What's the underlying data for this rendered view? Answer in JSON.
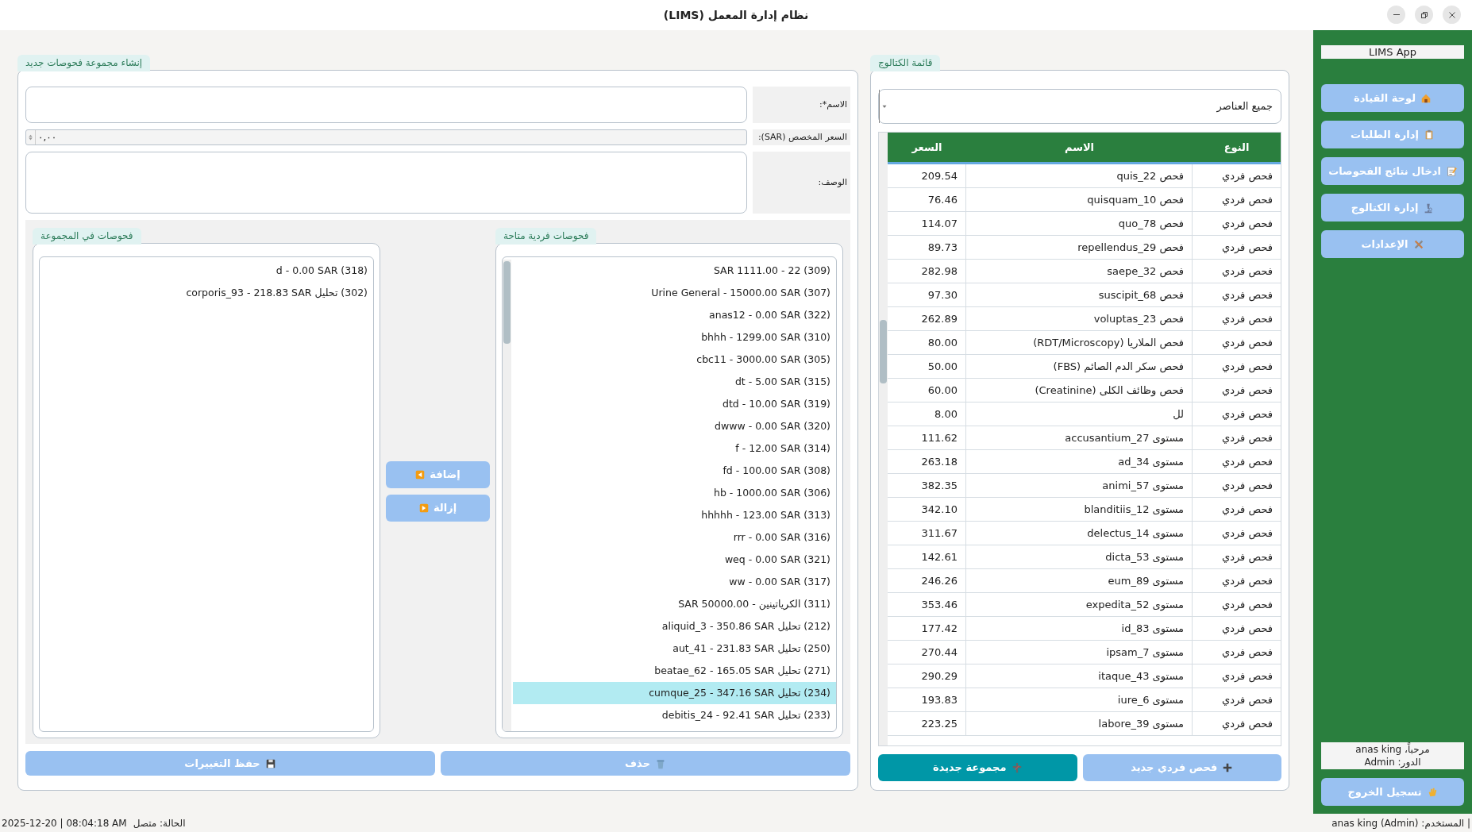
{
  "window": {
    "title": "نظام إدارة المعمل (LIMS)"
  },
  "create_group": {
    "title": "إنشاء مجموعة فحوصات جديد",
    "fields": [
      {
        "label": "الاسم*:",
        "kind": "text"
      },
      {
        "label": "السعر المخصص (SAR):",
        "kind": "spin",
        "value": "٠,٠٠"
      },
      {
        "label": "الوصف:",
        "kind": "textarea"
      }
    ],
    "group_tests": {
      "title": "فحوصات في المجموعة",
      "items": [
        {
          "text": "(318) d - 0.00 SAR",
          "selected": false
        },
        {
          "text": "(302) تحليل corporis_93 - 218.83 SAR",
          "selected": false
        }
      ]
    },
    "available_tests": {
      "title": "فحوصات فردية متاحة",
      "items": [
        {
          "text": "(309) 22 - 1111.00 SAR",
          "selected": false
        },
        {
          "text": "(307) Urine General - 15000.00 SAR",
          "selected": false
        },
        {
          "text": "(322) anas12 - 0.00 SAR",
          "selected": false
        },
        {
          "text": "(310) bhhh - 1299.00 SAR",
          "selected": false
        },
        {
          "text": "(305) cbc11 - 3000.00 SAR",
          "selected": false
        },
        {
          "text": "(315) dt - 5.00 SAR",
          "selected": false
        },
        {
          "text": "(319) dtd - 10.00 SAR",
          "selected": false
        },
        {
          "text": "(320) dwww - 0.00 SAR",
          "selected": false
        },
        {
          "text": "(314) f - 12.00 SAR",
          "selected": false
        },
        {
          "text": "(308) fd - 100.00 SAR",
          "selected": false
        },
        {
          "text": "(306) hb - 1000.00 SAR",
          "selected": false
        },
        {
          "text": "(313) hhhhh - 123.00 SAR",
          "selected": false
        },
        {
          "text": "(316) rrr - 0.00 SAR",
          "selected": false
        },
        {
          "text": "(321) weq - 0.00 SAR",
          "selected": false
        },
        {
          "text": "(317) ww - 0.00 SAR",
          "selected": false
        },
        {
          "text": "(311) الكرياتينين - 50000.00 SAR",
          "selected": false
        },
        {
          "text": "(212) تحليل aliquid_3 - 350.86 SAR",
          "selected": false
        },
        {
          "text": "(250) تحليل aut_41 - 231.83 SAR",
          "selected": false
        },
        {
          "text": "(271) تحليل beatae_62 - 165.05 SAR",
          "selected": false
        },
        {
          "text": "(234) تحليل cumque_25 - 347.16 SAR",
          "selected": true
        },
        {
          "text": "(233) تحليل debitis_24 - 92.41 SAR",
          "selected": false
        }
      ]
    },
    "add_button": "إضافة",
    "remove_button": "إزالة",
    "delete_button": "حذف",
    "save_button": "حفظ التغييرات"
  },
  "catalog": {
    "title": "قائمة الكتالوج",
    "filter": "جميع العناصر",
    "table": {
      "columns": [
        "النوع",
        "الاسم",
        "السعر"
      ],
      "rows": [
        [
          "فحص فردي",
          "فحص quis_22",
          "209.54"
        ],
        [
          "فحص فردي",
          "فحص quisquam_10",
          "76.46"
        ],
        [
          "فحص فردي",
          "فحص quo_78",
          "114.07"
        ],
        [
          "فحص فردي",
          "فحص repellendus_29",
          "89.73"
        ],
        [
          "فحص فردي",
          "فحص saepe_32",
          "282.98"
        ],
        [
          "فحص فردي",
          "فحص suscipit_68",
          "97.30"
        ],
        [
          "فحص فردي",
          "فحص voluptas_23",
          "262.89"
        ],
        [
          "فحص فردي",
          "فحص الملاريا (RDT/Microscopy)",
          "80.00"
        ],
        [
          "فحص فردي",
          "فحص سكر الدم الصائم (FBS)",
          "50.00"
        ],
        [
          "فحص فردي",
          "فحص وظائف الكلى (Creatinine)",
          "60.00"
        ],
        [
          "فحص فردي",
          "لل",
          "8.00"
        ],
        [
          "فحص فردي",
          "مستوى accusantium_27",
          "111.62"
        ],
        [
          "فحص فردي",
          "مستوى ad_34",
          "263.18"
        ],
        [
          "فحص فردي",
          "مستوى animi_57",
          "382.35"
        ],
        [
          "فحص فردي",
          "مستوى blanditiis_12",
          "342.10"
        ],
        [
          "فحص فردي",
          "مستوى delectus_14",
          "311.67"
        ],
        [
          "فحص فردي",
          "مستوى dicta_53",
          "142.61"
        ],
        [
          "فحص فردي",
          "مستوى eum_89",
          "246.26"
        ],
        [
          "فحص فردي",
          "مستوى expedita_52",
          "353.46"
        ],
        [
          "فحص فردي",
          "مستوى id_83",
          "177.42"
        ],
        [
          "فحص فردي",
          "مستوى ipsam_7",
          "270.44"
        ],
        [
          "فحص فردي",
          "مستوى itaque_43",
          "290.29"
        ],
        [
          "فحص فردي",
          "مستوى iure_6",
          "193.83"
        ],
        [
          "فحص فردي",
          "مستوى labore_39",
          "223.25"
        ]
      ]
    },
    "buttons": [
      {
        "label": "فحص فردي جديد",
        "kind": "plus",
        "highlighted": false
      },
      {
        "label": "مجموعة جديدة",
        "kind": "group",
        "highlighted": true
      }
    ]
  },
  "sidebar": {
    "app_name": "LIMS App",
    "items": [
      {
        "label": "لوحة القيادة",
        "kind": "home"
      },
      {
        "label": "إدارة الطلبات",
        "kind": "clipboard"
      },
      {
        "label": "ادخال نتائج الفحوصات",
        "kind": "memo"
      },
      {
        "label": "إدارة الكتالوج",
        "kind": "microscope"
      },
      {
        "label": "الإعدادات",
        "kind": "tools"
      }
    ],
    "welcome": "مرحباً، anas king",
    "role": "الدور: Admin",
    "logout": "تسجيل الخروج"
  },
  "status_bar": {
    "user": "| المستخدم: anas king (Admin)",
    "status": "الحالة: متصل",
    "datetime": "2025-12-20 | 08:04:18 AM"
  }
}
